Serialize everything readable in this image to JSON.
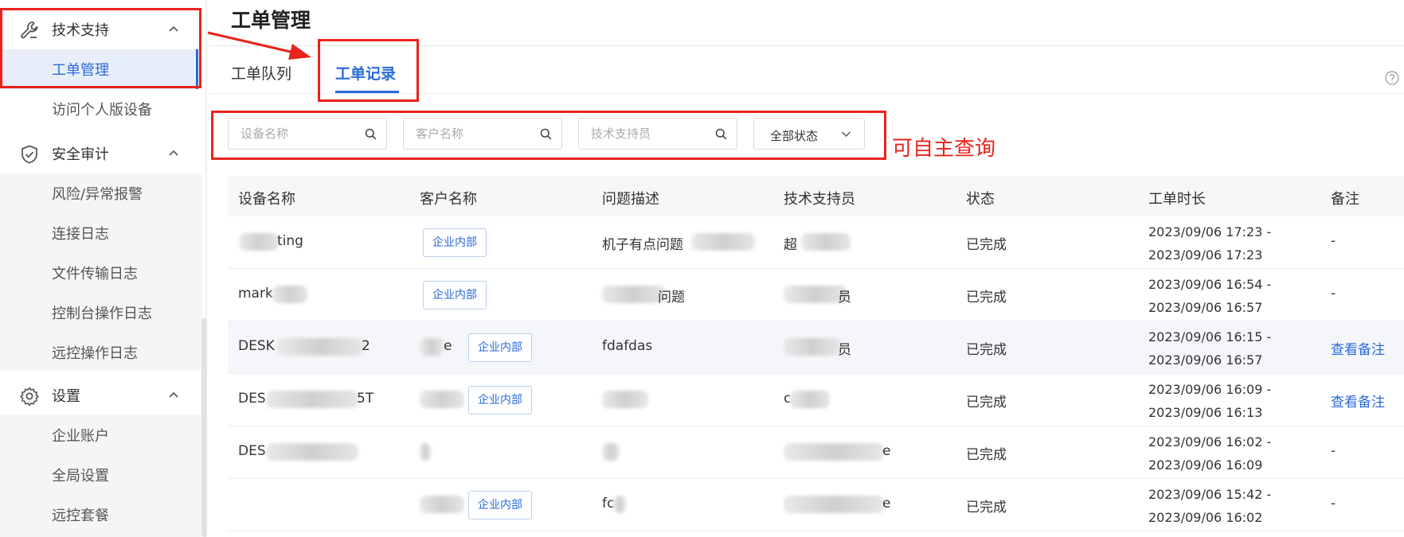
{
  "sidebar": {
    "sections": [
      {
        "label": "技术支持",
        "icon": "wrench-icon"
      },
      {
        "label": "安全审计",
        "icon": "shield-icon"
      },
      {
        "label": "设置",
        "icon": "gear-icon"
      }
    ],
    "items": {
      "ticket_mgmt": "工单管理",
      "personal_device": "访问个人版设备",
      "risk_alert": "风险/异常报警",
      "conn_log": "连接日志",
      "file_log": "文件传输日志",
      "console_log": "控制台操作日志",
      "remote_log": "远控操作日志",
      "enterprise_account": "企业账户",
      "global_settings": "全局设置",
      "remote_plan": "远控套餐"
    }
  },
  "header": {
    "title": "工单管理",
    "tabs": [
      {
        "label": "工单队列",
        "active": false
      },
      {
        "label": "工单记录",
        "active": true
      }
    ]
  },
  "search": {
    "device_placeholder": "设备名称",
    "customer_placeholder": "客户名称",
    "tech_placeholder": "技术支持员",
    "status_value": "全部状态"
  },
  "annotation": {
    "text": "可自主查询",
    "color": "#e8231c"
  },
  "table": {
    "headers": [
      "设备名称",
      "客户名称",
      "问题描述",
      "技术支持员",
      "状态",
      "工单时长",
      "备注"
    ],
    "rows": [
      {
        "device": "ting",
        "customer_tag": "企业内部",
        "issue": "机子有点问题",
        "tech": "超",
        "status": "已完成",
        "duration": "2023/09/06 17:23 - 2023/09/06 17:23",
        "note": "-"
      },
      {
        "device": "mark",
        "customer_tag": "企业内部",
        "issue": "问题",
        "tech": "员",
        "status": "已完成",
        "duration": "2023/09/06 16:54 - 2023/09/06 16:57",
        "note": "-"
      },
      {
        "device": "DESK",
        "device_tail": "2",
        "customer_prefix": "e",
        "customer_tag": "企业内部",
        "issue": "fdafdas",
        "tech": "员",
        "status": "已完成",
        "duration": "2023/09/06 16:15 - 2023/09/06 16:57",
        "note": "查看备注"
      },
      {
        "device": "DES",
        "device_tail": "5T",
        "customer_tag": "企业内部",
        "issue": "",
        "tech": "c",
        "status": "已完成",
        "duration": "2023/09/06 16:09 - 2023/09/06 16:13",
        "note": "查看备注"
      },
      {
        "device": "DES",
        "customer_tag": "",
        "issue": "",
        "tech": "e",
        "status": "已完成",
        "duration": "2023/09/06 16:02 - 2023/09/06 16:09",
        "note": "-"
      },
      {
        "device": "",
        "customer_tag": "企业内部",
        "issue": "fc",
        "tech": "e",
        "status": "已完成",
        "duration": "2023/09/06 15:42 - 2023/09/06 16:02",
        "note": "-"
      }
    ]
  },
  "colors": {
    "accent": "#2a6ad9",
    "annotation_red": "#e8231c"
  }
}
